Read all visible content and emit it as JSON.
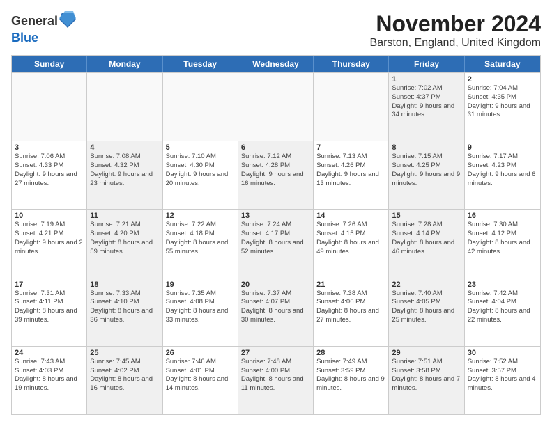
{
  "header": {
    "logo_line1": "General",
    "logo_line2": "Blue",
    "month_title": "November 2024",
    "location": "Barston, England, United Kingdom"
  },
  "weekdays": [
    "Sunday",
    "Monday",
    "Tuesday",
    "Wednesday",
    "Thursday",
    "Friday",
    "Saturday"
  ],
  "rows": [
    [
      {
        "day": "",
        "info": "",
        "empty": true
      },
      {
        "day": "",
        "info": "",
        "empty": true
      },
      {
        "day": "",
        "info": "",
        "empty": true
      },
      {
        "day": "",
        "info": "",
        "empty": true
      },
      {
        "day": "",
        "info": "",
        "empty": true
      },
      {
        "day": "1",
        "info": "Sunrise: 7:02 AM\nSunset: 4:37 PM\nDaylight: 9 hours and 34 minutes.",
        "shaded": true
      },
      {
        "day": "2",
        "info": "Sunrise: 7:04 AM\nSunset: 4:35 PM\nDaylight: 9 hours and 31 minutes.",
        "shaded": false
      }
    ],
    [
      {
        "day": "3",
        "info": "Sunrise: 7:06 AM\nSunset: 4:33 PM\nDaylight: 9 hours and 27 minutes.",
        "shaded": false
      },
      {
        "day": "4",
        "info": "Sunrise: 7:08 AM\nSunset: 4:32 PM\nDaylight: 9 hours and 23 minutes.",
        "shaded": true
      },
      {
        "day": "5",
        "info": "Sunrise: 7:10 AM\nSunset: 4:30 PM\nDaylight: 9 hours and 20 minutes.",
        "shaded": false
      },
      {
        "day": "6",
        "info": "Sunrise: 7:12 AM\nSunset: 4:28 PM\nDaylight: 9 hours and 16 minutes.",
        "shaded": true
      },
      {
        "day": "7",
        "info": "Sunrise: 7:13 AM\nSunset: 4:26 PM\nDaylight: 9 hours and 13 minutes.",
        "shaded": false
      },
      {
        "day": "8",
        "info": "Sunrise: 7:15 AM\nSunset: 4:25 PM\nDaylight: 9 hours and 9 minutes.",
        "shaded": true
      },
      {
        "day": "9",
        "info": "Sunrise: 7:17 AM\nSunset: 4:23 PM\nDaylight: 9 hours and 6 minutes.",
        "shaded": false
      }
    ],
    [
      {
        "day": "10",
        "info": "Sunrise: 7:19 AM\nSunset: 4:21 PM\nDaylight: 9 hours and 2 minutes.",
        "shaded": false
      },
      {
        "day": "11",
        "info": "Sunrise: 7:21 AM\nSunset: 4:20 PM\nDaylight: 8 hours and 59 minutes.",
        "shaded": true
      },
      {
        "day": "12",
        "info": "Sunrise: 7:22 AM\nSunset: 4:18 PM\nDaylight: 8 hours and 55 minutes.",
        "shaded": false
      },
      {
        "day": "13",
        "info": "Sunrise: 7:24 AM\nSunset: 4:17 PM\nDaylight: 8 hours and 52 minutes.",
        "shaded": true
      },
      {
        "day": "14",
        "info": "Sunrise: 7:26 AM\nSunset: 4:15 PM\nDaylight: 8 hours and 49 minutes.",
        "shaded": false
      },
      {
        "day": "15",
        "info": "Sunrise: 7:28 AM\nSunset: 4:14 PM\nDaylight: 8 hours and 46 minutes.",
        "shaded": true
      },
      {
        "day": "16",
        "info": "Sunrise: 7:30 AM\nSunset: 4:12 PM\nDaylight: 8 hours and 42 minutes.",
        "shaded": false
      }
    ],
    [
      {
        "day": "17",
        "info": "Sunrise: 7:31 AM\nSunset: 4:11 PM\nDaylight: 8 hours and 39 minutes.",
        "shaded": false
      },
      {
        "day": "18",
        "info": "Sunrise: 7:33 AM\nSunset: 4:10 PM\nDaylight: 8 hours and 36 minutes.",
        "shaded": true
      },
      {
        "day": "19",
        "info": "Sunrise: 7:35 AM\nSunset: 4:08 PM\nDaylight: 8 hours and 33 minutes.",
        "shaded": false
      },
      {
        "day": "20",
        "info": "Sunrise: 7:37 AM\nSunset: 4:07 PM\nDaylight: 8 hours and 30 minutes.",
        "shaded": true
      },
      {
        "day": "21",
        "info": "Sunrise: 7:38 AM\nSunset: 4:06 PM\nDaylight: 8 hours and 27 minutes.",
        "shaded": false
      },
      {
        "day": "22",
        "info": "Sunrise: 7:40 AM\nSunset: 4:05 PM\nDaylight: 8 hours and 25 minutes.",
        "shaded": true
      },
      {
        "day": "23",
        "info": "Sunrise: 7:42 AM\nSunset: 4:04 PM\nDaylight: 8 hours and 22 minutes.",
        "shaded": false
      }
    ],
    [
      {
        "day": "24",
        "info": "Sunrise: 7:43 AM\nSunset: 4:03 PM\nDaylight: 8 hours and 19 minutes.",
        "shaded": false
      },
      {
        "day": "25",
        "info": "Sunrise: 7:45 AM\nSunset: 4:02 PM\nDaylight: 8 hours and 16 minutes.",
        "shaded": true
      },
      {
        "day": "26",
        "info": "Sunrise: 7:46 AM\nSunset: 4:01 PM\nDaylight: 8 hours and 14 minutes.",
        "shaded": false
      },
      {
        "day": "27",
        "info": "Sunrise: 7:48 AM\nSunset: 4:00 PM\nDaylight: 8 hours and 11 minutes.",
        "shaded": true
      },
      {
        "day": "28",
        "info": "Sunrise: 7:49 AM\nSunset: 3:59 PM\nDaylight: 8 hours and 9 minutes.",
        "shaded": false
      },
      {
        "day": "29",
        "info": "Sunrise: 7:51 AM\nSunset: 3:58 PM\nDaylight: 8 hours and 7 minutes.",
        "shaded": true
      },
      {
        "day": "30",
        "info": "Sunrise: 7:52 AM\nSunset: 3:57 PM\nDaylight: 8 hours and 4 minutes.",
        "shaded": false
      }
    ]
  ]
}
